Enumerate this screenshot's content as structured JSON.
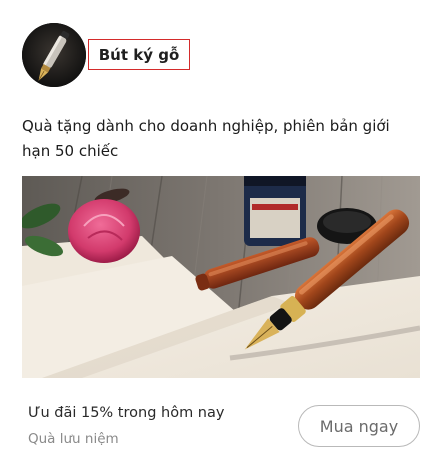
{
  "product": {
    "name": "Bút ký gỗ",
    "description": "Quà tặng dành cho doanh nghiệp, phiên bản giới hạn 50 chiếc"
  },
  "footer": {
    "offer_text": "Ưu đãi 15% trong hôm nay",
    "category": "Quà lưu niệm",
    "buy_label": "Mua ngay"
  },
  "colors": {
    "name_border": "#d42b2b",
    "button_border": "#b9b9b9"
  },
  "images": {
    "avatar": "fountain-pen-icon",
    "hero": "fountain-pen-with-ink-and-rose-photo"
  }
}
